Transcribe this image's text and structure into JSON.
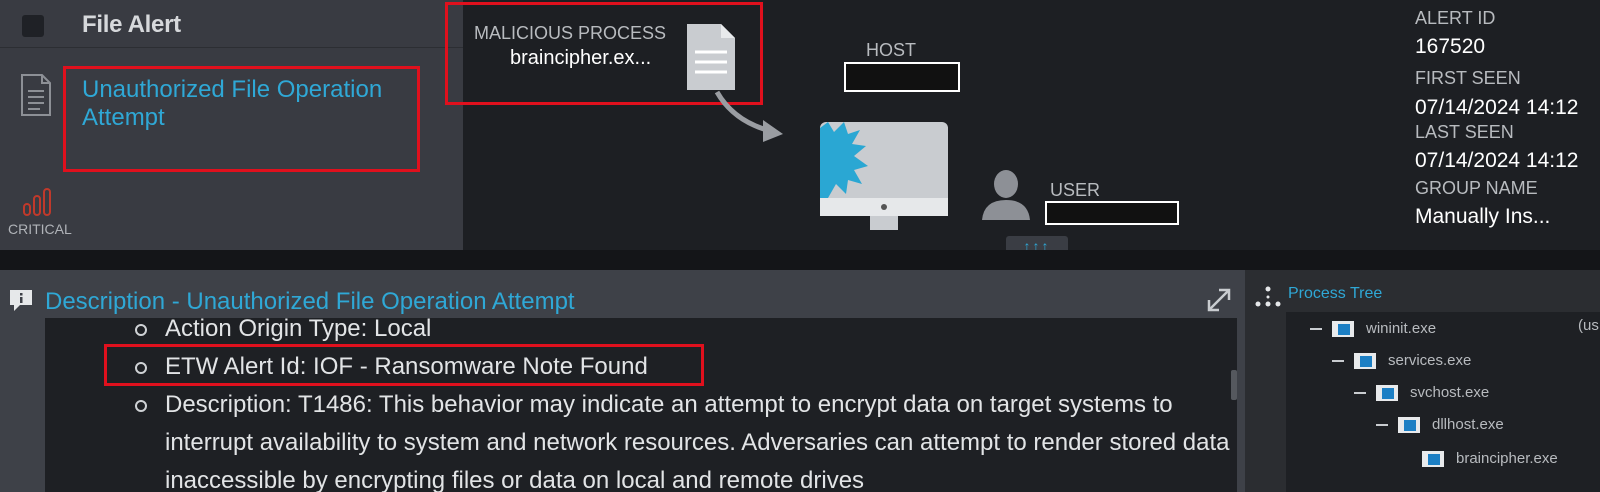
{
  "header": {
    "alert_type": "File Alert",
    "alert_name": "Unauthorized File Operation Attempt",
    "severity_label": "CRITICAL"
  },
  "process": {
    "label": "MALICIOUS PROCESS",
    "value": "braincipher.ex..."
  },
  "host": {
    "label": "HOST"
  },
  "user": {
    "label": "USER"
  },
  "expand_badge": "↑↑↑",
  "meta": {
    "alert_id_label": "ALERT ID",
    "alert_id": "167520",
    "first_seen_label": "FIRST SEEN",
    "first_seen": "07/14/2024 14:12",
    "last_seen_label": "LAST SEEN",
    "last_seen": "07/14/2024 14:12",
    "group_name_label": "GROUP NAME",
    "group_name": "Manually Ins..."
  },
  "description": {
    "title": "Description - Unauthorized File Operation Attempt",
    "items": [
      "Action Origin Type: Local",
      "ETW Alert Id: IOF - Ransomware Note Found",
      "Description: T1486: This behavior may indicate an attempt to encrypt data on target systems to interrupt availability to system and network resources. Adversaries can attempt to render stored data inaccessible by encrypting files or data on local and remote drives"
    ]
  },
  "process_tree": {
    "title": "Process Tree",
    "user_col": "(us",
    "nodes": [
      {
        "name": "wininit.exe"
      },
      {
        "name": "services.exe"
      },
      {
        "name": "svchost.exe"
      },
      {
        "name": "dllhost.exe"
      },
      {
        "name": "braincipher.exe"
      }
    ]
  },
  "icons": {
    "checkbox": "checkbox-icon",
    "document": "document-icon",
    "severity": "signal-bars-icon",
    "monitor": "monitor-icon",
    "user": "user-icon",
    "info": "info-icon",
    "expand": "expand-icon",
    "tree": "process-tree-icon",
    "windows_exe": "windows-exe-icon"
  },
  "colors": {
    "accent": "#2fa8d6",
    "highlight_box": "#e0101d",
    "critical": "#c0392b"
  }
}
